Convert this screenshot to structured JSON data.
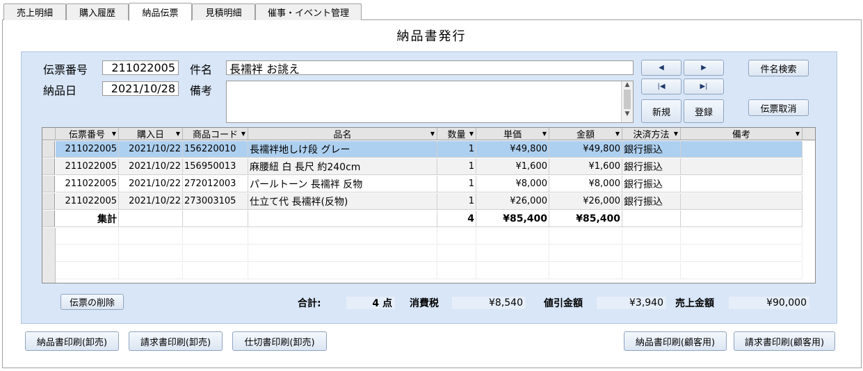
{
  "tabs": [
    "売上明細",
    "購入履歴",
    "納品伝票",
    "見積明細",
    "催事・イベント管理"
  ],
  "form_title": "納品書発行",
  "header": {
    "slip_no_label": "伝票番号",
    "slip_no": "211022005",
    "subject_label": "件名",
    "subject": "長襦袢 お誂え",
    "date_label": "納品日",
    "date": "2021/10/28",
    "memo_label": "備考",
    "memo": ""
  },
  "nav": {
    "prev_icon": "◀",
    "next_icon": "▶",
    "first_icon": "|◀",
    "last_icon": "▶|",
    "new": "新規",
    "register": "登録",
    "search": "件名検索",
    "cancel": "伝票取消"
  },
  "columns": [
    "伝票番号",
    "購入日",
    "商品コード",
    "品名",
    "数量",
    "単価",
    "金額",
    "決済方法",
    "備考"
  ],
  "rows": [
    [
      "211022005",
      "2021/10/22",
      "156220010",
      "長襦袢地しけ段 グレー",
      "1",
      "¥49,800",
      "¥49,800",
      "銀行振込",
      ""
    ],
    [
      "211022005",
      "2021/10/22",
      "156950013",
      "麻腰紐 白 長尺 約240cm",
      "1",
      "¥1,600",
      "¥1,600",
      "銀行振込",
      ""
    ],
    [
      "211022005",
      "2021/10/22",
      "272012003",
      "パールトーン 長襦袢 反物",
      "1",
      "¥8,000",
      "¥8,000",
      "銀行振込",
      ""
    ],
    [
      "211022005",
      "2021/10/22",
      "273003105",
      "仕立て代 長襦袢(反物)",
      "1",
      "¥26,000",
      "¥26,000",
      "銀行振込",
      ""
    ]
  ],
  "summary_row": {
    "label": "集計",
    "qty": "4",
    "unit": "¥85,400",
    "amount": "¥85,400"
  },
  "delete_button": "伝票の削除",
  "totals": {
    "total_label": "合計:",
    "count": "4 点",
    "tax_label": "消費税",
    "tax": "¥8,540",
    "discount_label": "値引金額",
    "discount": "¥3,940",
    "sales_label": "売上金額",
    "sales": "¥90,000"
  },
  "print_buttons": [
    "納品書印刷(卸売)",
    "請求書印刷(卸売)",
    "仕切書印刷(卸売)",
    "納品書印刷(顧客用)",
    "請求書印刷(顧客用)"
  ]
}
